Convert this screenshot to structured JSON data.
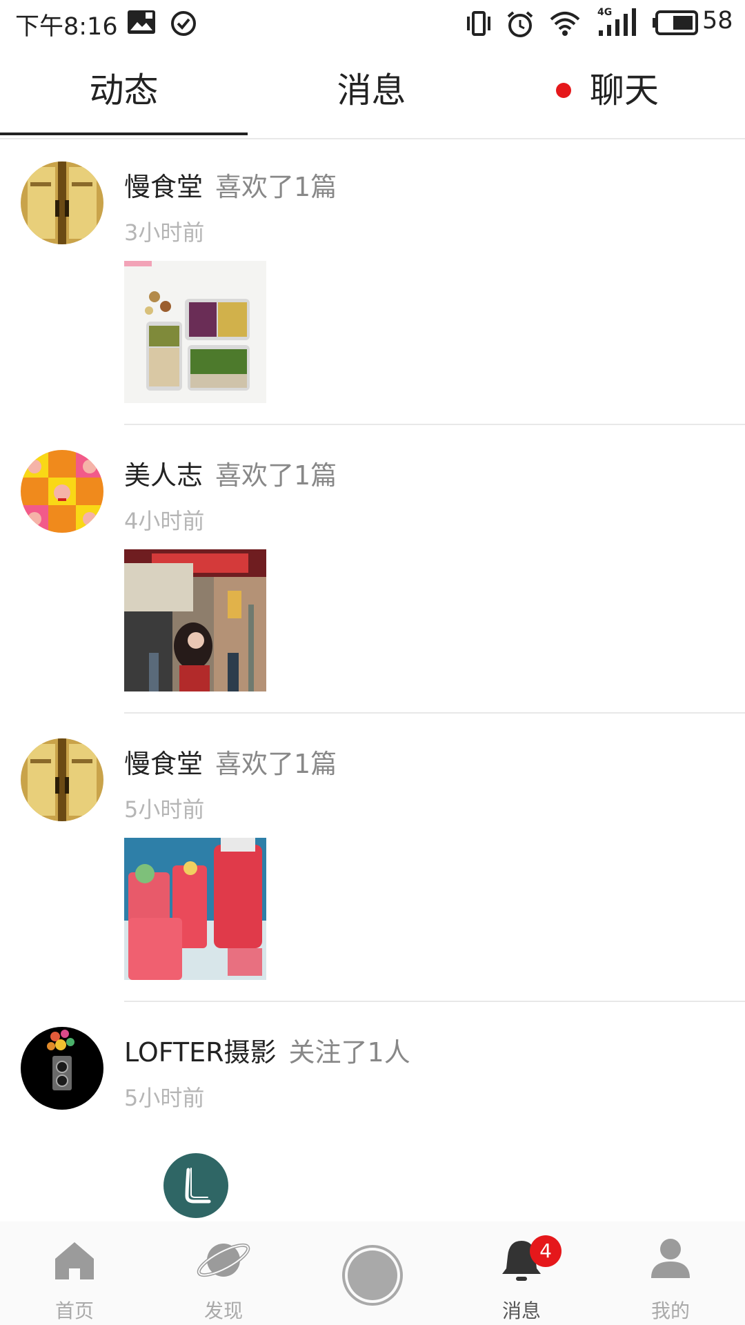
{
  "status_bar": {
    "time": "下午8:16",
    "battery": "58",
    "network": "4G",
    "icons": [
      "image-icon",
      "check-circle-icon",
      "vibrate-icon",
      "alarm-icon",
      "wifi-icon",
      "signal-icon",
      "battery-icon"
    ]
  },
  "tabs": [
    {
      "label": "动态",
      "active": true
    },
    {
      "label": "消息",
      "active": false
    },
    {
      "label": "聊天",
      "active": false,
      "has_dot": true
    }
  ],
  "feed": [
    {
      "name": "慢食堂",
      "action": "喜欢了1篇",
      "time": "3小时前",
      "avatar": "restaurant-door",
      "thumb": "meal-prep-boxes"
    },
    {
      "name": "美人志",
      "action": "喜欢了1篇",
      "time": "4小时前",
      "avatar": "pop-art-portraits",
      "thumb": "cafe-street-girl"
    },
    {
      "name": "慢食堂",
      "action": "喜欢了1篇",
      "time": "5小时前",
      "avatar": "restaurant-door",
      "thumb": "watermelon-drinks"
    },
    {
      "name": "LOFTER摄影",
      "action": "关注了1人",
      "time": "5小时前",
      "avatar": "camera-bokeh",
      "thumb": null
    }
  ],
  "bottom_nav": [
    {
      "label": "首页",
      "icon": "home-icon"
    },
    {
      "label": "发现",
      "icon": "planet-icon"
    },
    {
      "label": "",
      "icon": "camera-button-icon"
    },
    {
      "label": "消息",
      "icon": "bell-icon",
      "badge": "4",
      "active": true
    },
    {
      "label": "我的",
      "icon": "user-icon"
    }
  ],
  "colors": {
    "accent_red": "#e5181b",
    "fab_teal": "#2f6665",
    "muted": "#888888"
  }
}
